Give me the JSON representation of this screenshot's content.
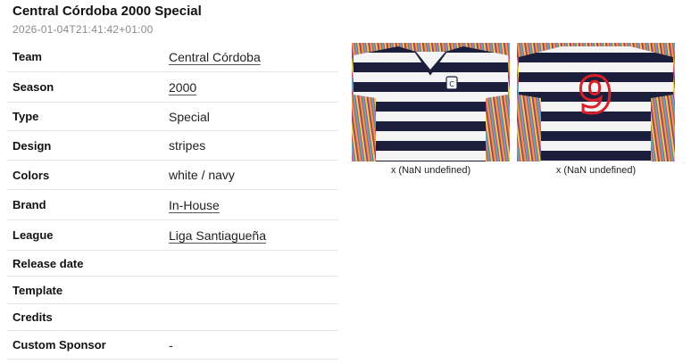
{
  "page": {
    "title": "Central Córdoba 2000 Special",
    "timestamp": "2026-01-04T21:41:42+01:00"
  },
  "details": [
    {
      "label": "Team",
      "value": "Central Córdoba",
      "link": true
    },
    {
      "label": "Season",
      "value": "2000",
      "link": true
    },
    {
      "label": "Type",
      "value": "Special",
      "link": false
    },
    {
      "label": "Design",
      "value": "stripes",
      "link": false
    },
    {
      "label": "Colors",
      "value": "white / navy",
      "link": false
    },
    {
      "label": "Brand",
      "value": "In-House",
      "link": true
    },
    {
      "label": "League",
      "value": "Liga Santiagueña",
      "link": true
    },
    {
      "label": "Release date",
      "value": "",
      "link": false
    },
    {
      "label": "Template",
      "value": "",
      "link": false
    },
    {
      "label": "Credits",
      "value": "",
      "link": false
    },
    {
      "label": "Custom Sponsor",
      "value": "-",
      "link": false
    }
  ],
  "gallery": [
    {
      "caption": "x (NaN undefined)",
      "view": "front"
    },
    {
      "caption": "x (NaN undefined)",
      "view": "back",
      "number": "9"
    }
  ],
  "colors": {
    "navy": "#1b1f3b",
    "white": "#f4f4f4",
    "number_red": "#d8202a"
  }
}
